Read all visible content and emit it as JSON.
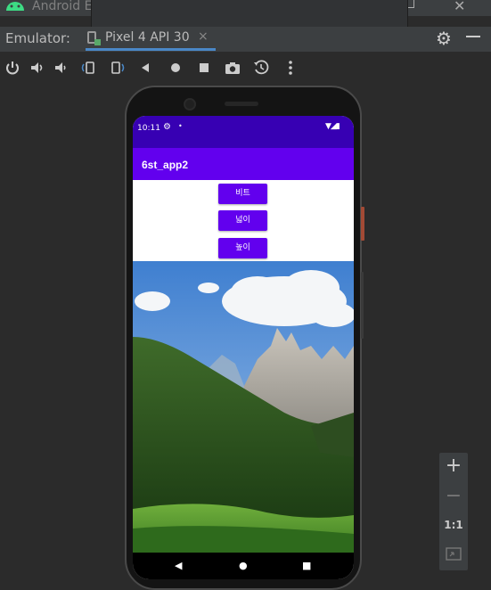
{
  "window": {
    "title": "Android E"
  },
  "tabbar": {
    "label": "Emulator:",
    "tab_label": "Pixel 4 API 30",
    "tab_close": "×"
  },
  "toolbar": {
    "icons": [
      "power-icon",
      "volume-up-icon",
      "volume-down-icon",
      "rotate-left-icon",
      "rotate-right-icon",
      "back-icon",
      "home-icon",
      "overview-icon",
      "camera-icon",
      "snapshot-icon",
      "more-icon"
    ]
  },
  "device": {
    "status_time": "10:11",
    "app_title": "6st_app2",
    "buttons": [
      "비트",
      "넓이",
      "높이"
    ]
  },
  "zoom": {
    "in": "+",
    "out": "−",
    "actual": "1:1"
  },
  "colors": {
    "primary": "#6200ee",
    "primary_dark": "#3700b3",
    "ide_bg": "#2b2b2b",
    "ide_panel": "#3c3f41",
    "accent_tab": "#4a88c7"
  }
}
